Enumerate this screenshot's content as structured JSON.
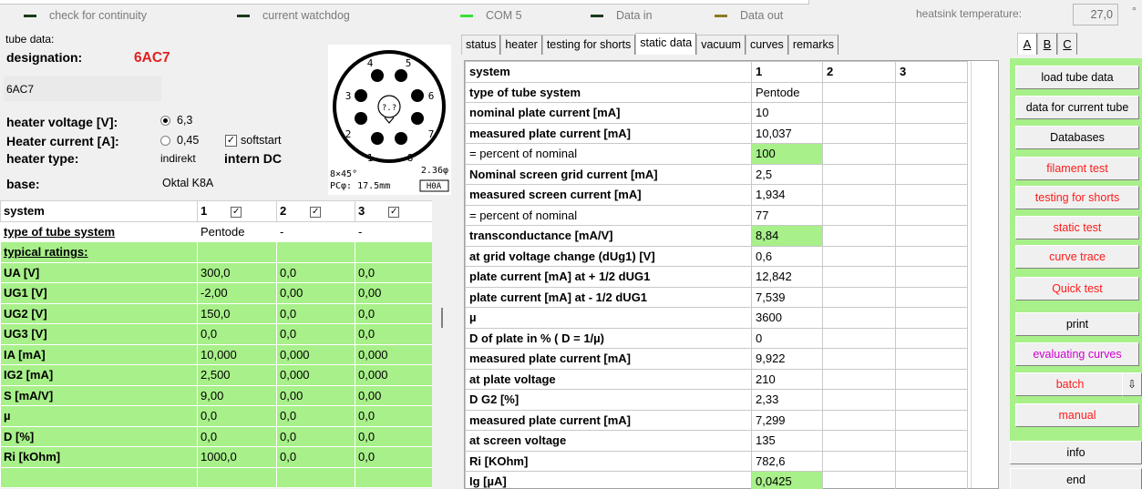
{
  "status_bar": {
    "indicators": [
      {
        "label": "check for continuity",
        "color": "#1a3a1a"
      },
      {
        "label": "current watchdog",
        "color": "#1a3a1a"
      },
      {
        "label": "COM 5",
        "color": "#3be03b"
      },
      {
        "label": "Data in",
        "color": "#1a3a1a"
      },
      {
        "label": "Data out",
        "color": "#8c7a22"
      }
    ],
    "heatsink_label": "heatsink temperature:",
    "heatsink_value": "27,0",
    "heatsink_unit": "°"
  },
  "tube": {
    "group_label": "tube data:",
    "designation_label": "designation:",
    "designation": "6AC7",
    "designation_input": "6AC7",
    "heater_voltage_label": "heater voltage [V]:",
    "heater_current_label": "Heater current [A]:",
    "heater_type_label": "heater type:",
    "voltage_option_1": "6,3",
    "voltage_option_2": "0,45",
    "softstart_label": "softstart",
    "heater_type": "indirekt",
    "heater_supply": "intern DC",
    "base_label": "base:",
    "base": "Oktal K8A",
    "socket": {
      "pins": [
        "1",
        "2",
        "3",
        "4",
        "5",
        "6",
        "7",
        "8"
      ],
      "center_label": "?.?",
      "note_1": "8×45°",
      "note_2": "2.36φ",
      "note_3": "PCφ: 17.5mm",
      "note_4": "H0A"
    }
  },
  "left_table": {
    "headers": [
      "system",
      "1",
      "2",
      "3"
    ],
    "rows": [
      {
        "label": "type of tube system",
        "v": [
          "Pentode",
          "-",
          "-"
        ],
        "style": "plain",
        "underline": true
      },
      {
        "label": "typical ratings:",
        "v": [
          "",
          "",
          ""
        ],
        "style": "g",
        "underline": true
      },
      {
        "label": "UA [V]",
        "v": [
          "300,0",
          "0,0",
          "0,0"
        ],
        "style": "g"
      },
      {
        "label": "UG1 [V]",
        "v": [
          "-2,00",
          "0,00",
          "0,00"
        ],
        "style": "g"
      },
      {
        "label": "UG2 [V]",
        "v": [
          "150,0",
          "0,0",
          "0,0"
        ],
        "style": "g"
      },
      {
        "label": "UG3 [V]",
        "v": [
          "0,0",
          "0,0",
          "0,0"
        ],
        "style": "g"
      },
      {
        "label": "IA [mA]",
        "v": [
          "10,000",
          "0,000",
          "0,000"
        ],
        "style": "g"
      },
      {
        "label": "IG2 [mA]",
        "v": [
          "2,500",
          "0,000",
          "0,000"
        ],
        "style": "g"
      },
      {
        "label": "S [mA/V]",
        "v": [
          "9,00",
          "0,00",
          "0,00"
        ],
        "style": "g"
      },
      {
        "label": "µ",
        "v": [
          "0,0",
          "0,0",
          "0,0"
        ],
        "style": "g"
      },
      {
        "label": "D [%]",
        "v": [
          "0,0",
          "0,0",
          "0,0"
        ],
        "style": "g"
      },
      {
        "label": "Ri [kOhm]",
        "v": [
          "1000,0",
          "0,0",
          "0,0"
        ],
        "style": "g"
      },
      {
        "label": "",
        "v": [
          "",
          "",
          ""
        ],
        "style": "g"
      }
    ]
  },
  "tabs": [
    "status",
    "heater",
    "testing for shorts",
    "static data",
    "vacuum",
    "curves",
    "remarks"
  ],
  "active_tab": "static data",
  "static_table": {
    "headers": [
      "system",
      "1",
      "2",
      "3"
    ],
    "rows": [
      {
        "label": "type of tube system",
        "v": "Pentode"
      },
      {
        "label": "nominal plate current [mA]",
        "v": "10"
      },
      {
        "label": "measured plate current [mA]",
        "v": "10,037"
      },
      {
        "label": "= percent of nominal",
        "v": "100",
        "green": true,
        "normal": true
      },
      {
        "label": "Nominal screen grid current [mA]",
        "v": "2,5"
      },
      {
        "label": "measured screen current [mA]",
        "v": "1,934"
      },
      {
        "label": "= percent of nominal",
        "v": "77",
        "normal": true
      },
      {
        "label": "transconductance [mA/V]",
        "v": "8,84",
        "green": true
      },
      {
        "label": "at grid voltage change (dUg1) [V]",
        "v": "0,6"
      },
      {
        "label": "plate current [mA] at + 1/2 dUG1",
        "v": "12,842"
      },
      {
        "label": "plate current [mA] at - 1/2 dUG1",
        "v": "7,539"
      },
      {
        "label": "µ",
        "v": "3600"
      },
      {
        "label": "D of plate in % ( D = 1/µ)",
        "v": "0"
      },
      {
        "label": "measured plate current [mA]",
        "v": "9,922"
      },
      {
        "label": "at plate voltage",
        "v": "210"
      },
      {
        "label": "D G2 [%]",
        "v": "2,33"
      },
      {
        "label": "measured plate current [mA]",
        "v": "7,299"
      },
      {
        "label": "at screen voltage",
        "v": "135"
      },
      {
        "label": "Ri [KOhm]",
        "v": "782,6"
      },
      {
        "label": "Ig [µA]",
        "v": "0,0425",
        "green": true
      }
    ]
  },
  "right_tabs": [
    "A",
    "B",
    "C"
  ],
  "buttons": {
    "load": "load tube data",
    "current_tube": "data for current tube",
    "databases": "Databases",
    "filament": "filament test",
    "shorts": "testing for shorts",
    "static": "static test",
    "curve": "curve trace",
    "quick": "Quick test",
    "print": "print",
    "evaluating": "evaluating curves",
    "batch": "batch",
    "batch_arrow": "⇩",
    "manual": "manual",
    "info": "info",
    "end": "end"
  },
  "colors": {
    "green_cell": "#a8f08a",
    "red_text": "#ff1a1a",
    "designation_red": "#e02020",
    "magenta_text": "#d000d0"
  }
}
